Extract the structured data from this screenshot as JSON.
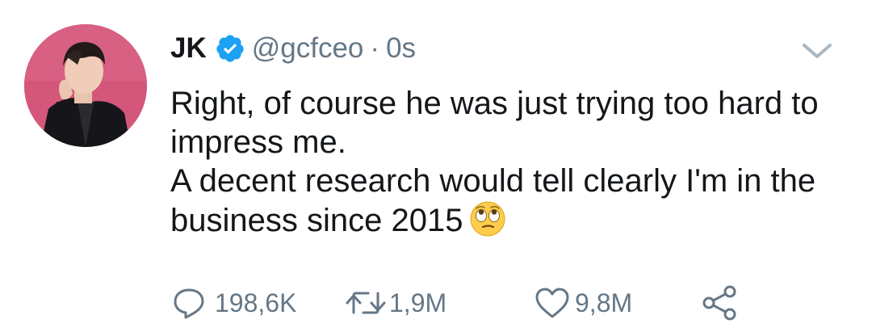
{
  "tweet": {
    "author": {
      "display_name": "JK",
      "handle": "@gcfceo",
      "verified": true,
      "avatar": "profile-photo"
    },
    "separator": "·",
    "timestamp": "0s",
    "text_lines": [
      "Right, of course he was just trying too hard to impress me.",
      "A decent research would tell clearly I'm in the business since 2015"
    ],
    "emoji": "face-with-rolling-eyes",
    "actions": {
      "reply": {
        "icon": "reply-icon",
        "count": "198,6K"
      },
      "retweet": {
        "icon": "retweet-icon",
        "count": "1,9M"
      },
      "like": {
        "icon": "heart-icon",
        "count": "9,8M"
      },
      "share": {
        "icon": "share-icon"
      }
    }
  },
  "colors": {
    "text_primary": "#14171a",
    "text_secondary": "#657786",
    "verified_blue": "#1da1f2",
    "avatar_background": "#d4567a"
  }
}
